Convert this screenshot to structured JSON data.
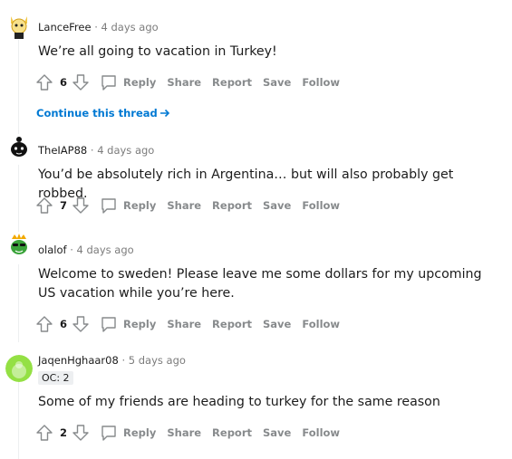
{
  "comments": [
    {
      "username": "LanceFree",
      "time": "4 days ago",
      "flair": "",
      "body": "We’re all going to vacation in Turkey!",
      "votes": "6"
    },
    {
      "username": "TheIAP88",
      "time": "4 days ago",
      "flair": "",
      "body": "You’d be absolutely rich in Argentina… but will also probably get robbed.",
      "votes": "7"
    },
    {
      "username": "olalof",
      "time": "4 days ago",
      "flair": "",
      "body": "Welcome to sweden! Please leave me some dollars for my upcoming US vacation while you’re here.",
      "votes": "6"
    },
    {
      "username": "JaqenHghaar08",
      "time": "5 days ago",
      "flair": "OC: 2",
      "body": "Some of my friends are heading to turkey for the same reason",
      "votes": "2"
    }
  ],
  "actions": {
    "reply": "Reply",
    "share": "Share",
    "report": "Report",
    "save": "Save",
    "follow": "Follow"
  },
  "continue_thread": "Continue this thread",
  "separator": "·",
  "colors": {
    "link": "#0079d3",
    "muted": "#878a8c",
    "divider": "#edeff1"
  },
  "icons": [
    "upvote-icon",
    "downvote-icon",
    "reply-bubble-icon",
    "arrow-right-icon"
  ]
}
